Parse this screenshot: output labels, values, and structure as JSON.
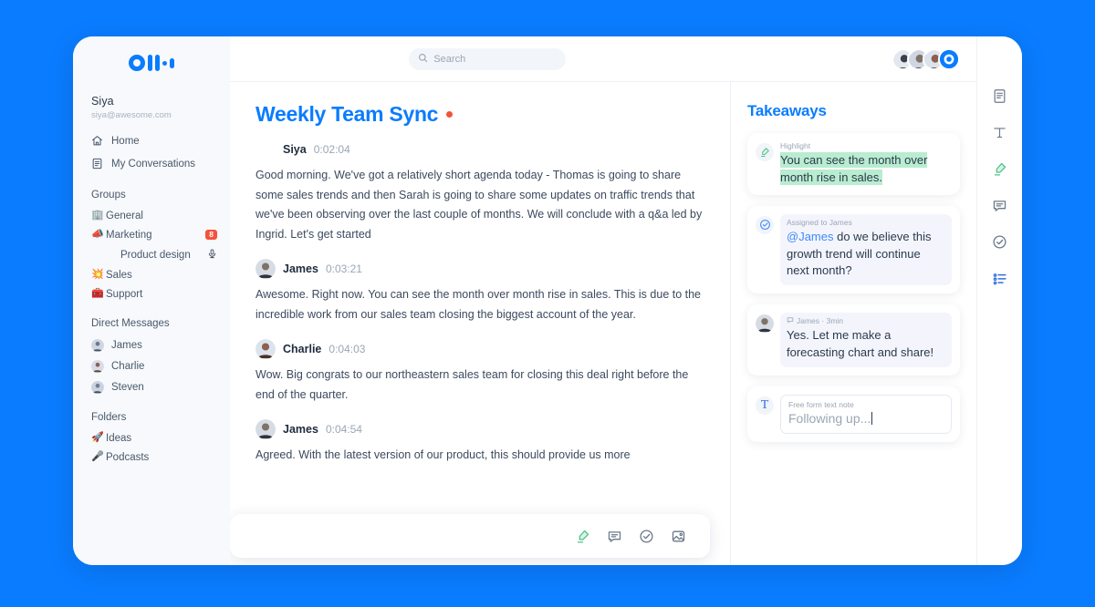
{
  "brand": {
    "name": "Otter",
    "accent": "#0a7cff",
    "highlight": "#b9ecd0",
    "badge_color": "#f4523c"
  },
  "sidebar": {
    "user": {
      "name": "Siya",
      "email": "siya@awesome.com"
    },
    "nav": [
      {
        "label": "Home",
        "icon": "home-icon"
      },
      {
        "label": "My Conversations",
        "icon": "document-icon"
      }
    ],
    "groups_title": "Groups",
    "groups": [
      {
        "label": "General",
        "emoji": "🏢",
        "badge": "",
        "mic": false,
        "indent": false
      },
      {
        "label": "Marketing",
        "emoji": "📣",
        "badge": "8",
        "mic": false,
        "indent": false
      },
      {
        "label": "Product design",
        "emoji": "",
        "badge": "",
        "mic": true,
        "indent": true
      },
      {
        "label": "Sales",
        "emoji": "💥",
        "badge": "",
        "mic": false,
        "indent": false
      },
      {
        "label": "Support",
        "emoji": "🧰",
        "badge": "",
        "mic": false,
        "indent": false
      }
    ],
    "dm_title": "Direct Messages",
    "dms": [
      {
        "label": "James"
      },
      {
        "label": "Charlie"
      },
      {
        "label": "Steven"
      }
    ],
    "folders_title": "Folders",
    "folders": [
      {
        "label": "Ideas",
        "emoji": "🚀"
      },
      {
        "label": "Podcasts",
        "emoji": "🎤"
      }
    ]
  },
  "topbar": {
    "search_placeholder": "Search",
    "avatars": [
      {
        "name": "participant-1"
      },
      {
        "name": "participant-2"
      },
      {
        "name": "participant-3"
      },
      {
        "name": "record-status"
      }
    ]
  },
  "transcript": {
    "title": "Weekly Team Sync",
    "recording": true,
    "messages": [
      {
        "speaker": "Siya",
        "time": "0:02:04",
        "avatar": false,
        "text": "Good morning. We've got a relatively short agenda today - Thomas is going to share some sales trends and then Sarah is going to share some updates on traffic trends that we've been observing over the last couple of months. We will conclude with a q&a led by Ingrid. Let's get started"
      },
      {
        "speaker": "James",
        "time": "0:03:21",
        "avatar": true,
        "text": "Awesome. Right now. You can see the month over month rise in sales. This is due to the incredible work from our sales team closing the biggest account of the year."
      },
      {
        "speaker": "Charlie",
        "time": "0:04:03",
        "avatar": true,
        "text": "Wow. Big congrats to our northeastern sales team for closing this deal right before the end of the quarter."
      },
      {
        "speaker": "James",
        "time": "0:04:54",
        "avatar": true,
        "text": "Agreed. With the latest version of our product, this should provide us more"
      }
    ],
    "toolbar": [
      {
        "label": "Highlight",
        "icon": "highlighter-icon"
      },
      {
        "label": "Comment",
        "icon": "comment-icon"
      },
      {
        "label": "Action item",
        "icon": "check-circle-icon"
      },
      {
        "label": "Image",
        "icon": "image-icon"
      }
    ]
  },
  "takeaways": {
    "title": "Takeaways",
    "cards": [
      {
        "type": "highlight",
        "icon": "highlighter-icon",
        "kicker": "Highlight",
        "text_lines": [
          "You can see the month over",
          "month rise in sales."
        ]
      },
      {
        "type": "assigned",
        "icon": "check-circle-icon",
        "kicker": "Assigned to James",
        "mention": "@James",
        "text": " do we believe this growth trend will continue next month?"
      },
      {
        "type": "comment",
        "icon": "avatar-james",
        "kicker": "James · 3min",
        "text": "Yes. Let me make a forecasting chart and share!"
      },
      {
        "type": "note",
        "icon": "text-icon",
        "kicker": "Free form text note",
        "value": "Following up..."
      }
    ]
  },
  "rail": {
    "items": [
      {
        "name": "notes-icon"
      },
      {
        "name": "text-icon"
      },
      {
        "name": "highlighter-icon"
      },
      {
        "name": "comment-icon"
      },
      {
        "name": "check-circle-icon"
      },
      {
        "name": "outline-icon"
      }
    ]
  }
}
